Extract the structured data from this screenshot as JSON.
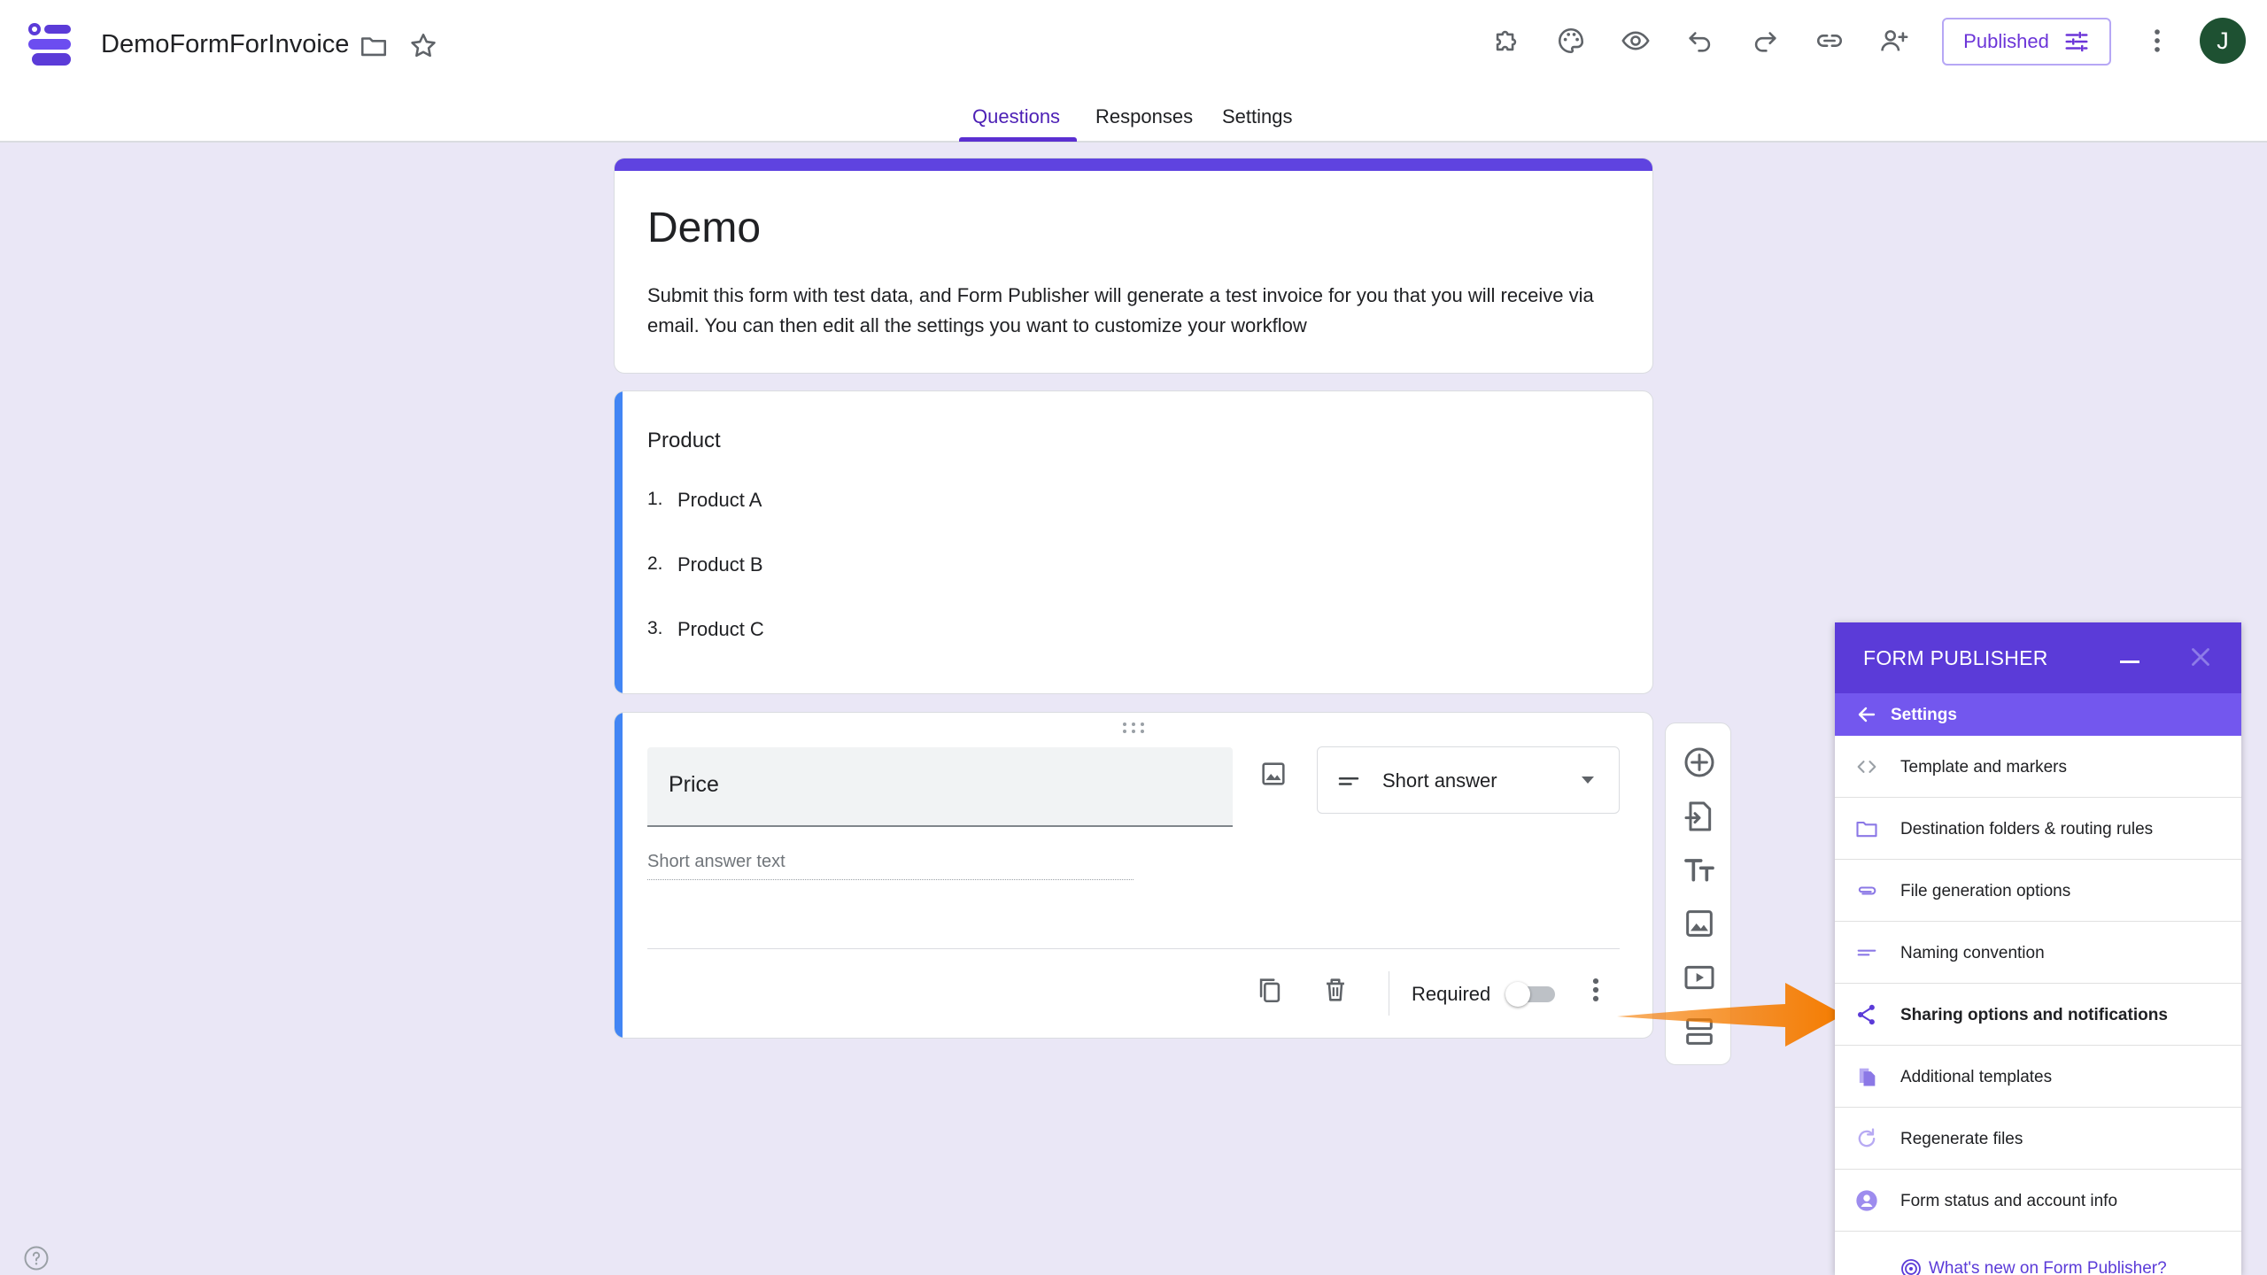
{
  "header": {
    "doc_title": "DemoFormForInvoice",
    "published_label": "Published",
    "avatar_letter": "J"
  },
  "tabs": [
    {
      "label": "Questions",
      "active": true
    },
    {
      "label": "Responses",
      "active": false
    },
    {
      "label": "Settings",
      "active": false
    }
  ],
  "form": {
    "title": "Demo",
    "description": "Submit this form with test data, and Form Publisher will generate a test invoice for you that you will receive via email. You can then edit all the settings you want to customize your workflow",
    "accent_color": "#5f43e0"
  },
  "product_question": {
    "title": "Product",
    "items": [
      {
        "num": "1.",
        "label": "Product A"
      },
      {
        "num": "2.",
        "label": "Product B"
      },
      {
        "num": "3.",
        "label": "Product C"
      }
    ]
  },
  "price_question": {
    "title": "Price",
    "type_label": "Short answer",
    "answer_placeholder": "Short answer text",
    "required_label": "Required",
    "required": false
  },
  "form_publisher": {
    "title": "FORM PUBLISHER",
    "section": "Settings",
    "items": [
      {
        "label": "Template and markers",
        "icon": "code-icon"
      },
      {
        "label": "Destination folders & routing rules",
        "icon": "folder-icon"
      },
      {
        "label": "File generation options",
        "icon": "attachment-icon"
      },
      {
        "label": "Naming convention",
        "icon": "short-text-icon"
      },
      {
        "label": "Sharing options and notifications",
        "icon": "share-icon",
        "highlighted": true
      },
      {
        "label": "Additional templates",
        "icon": "copy-icon"
      },
      {
        "label": "Regenerate files",
        "icon": "refresh-icon"
      },
      {
        "label": "Form status and account info",
        "icon": "account-icon"
      }
    ],
    "footer_link": "What's new on Form Publisher?"
  },
  "colors": {
    "brand": "#5b3bd8",
    "brand_light": "#7357ee",
    "question_accent": "#4285f4",
    "annotation_arrow": "#f57c00"
  }
}
